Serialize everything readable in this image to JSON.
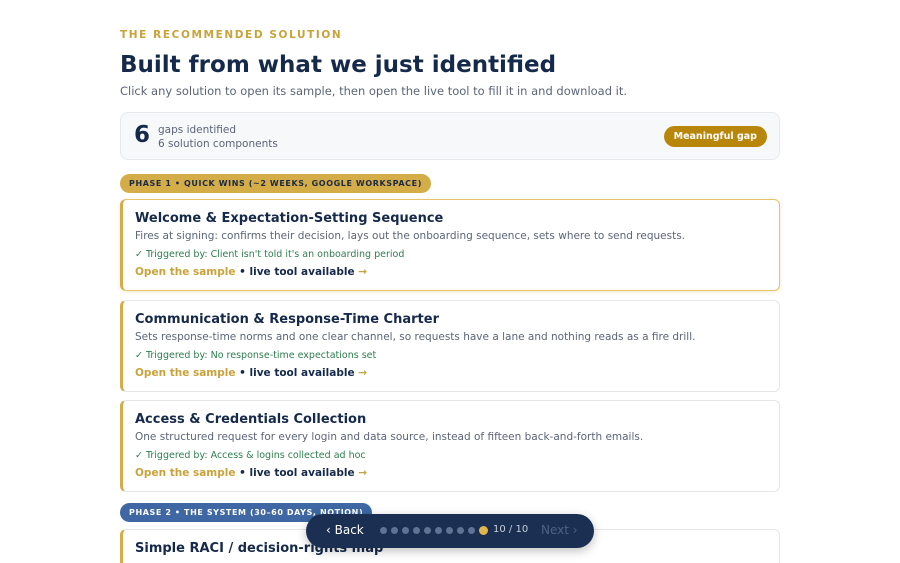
{
  "header": {
    "eyebrow": "THE RECOMMENDED SOLUTION",
    "title": "Built from what we just identified",
    "subtitle": "Click any solution to open its sample, then open the live tool to fill it in and download it."
  },
  "stats": {
    "number": "6",
    "line1": "gaps identified",
    "line2": "6 solution components",
    "badge": "Meaningful gap"
  },
  "phases": [
    {
      "label": "PHASE 1 • QUICK WINS (~2 WEEKS, GOOGLE WORKSPACE)",
      "color": "#d4ac48"
    },
    {
      "label": "PHASE 2 • THE SYSTEM (30–60 DAYS, NOTION)",
      "color": "#3e67a3"
    }
  ],
  "cards": [
    {
      "title": "Welcome & Expectation-Setting Sequence",
      "desc": "Fires at signing: confirms their decision, lays out the onboarding sequence, sets where to send requests.",
      "trigger": "✓ Triggered by: Client isn't told it's an onboarding period",
      "link_open": "Open the sample",
      "link_tool": " • live tool available",
      "arrow": " →"
    },
    {
      "title": "Communication & Response-Time Charter",
      "desc": "Sets response-time norms and one clear channel, so requests have a lane and nothing reads as a fire drill.",
      "trigger": "✓ Triggered by: No response-time expectations set",
      "link_open": "Open the sample",
      "link_tool": " • live tool available",
      "arrow": " →"
    },
    {
      "title": "Access & Credentials Collection",
      "desc": "One structured request for every login and data source, instead of fifteen back-and-forth emails.",
      "trigger": "✓ Triggered by: Access & logins collected ad hoc",
      "link_open": "Open the sample",
      "link_tool": " • live tool available",
      "arrow": " →"
    },
    {
      "title": "Simple RACI / decision-rights map"
    }
  ],
  "nav": {
    "back": "‹ Back",
    "count": "10 / 10",
    "next": "Next ›",
    "total_steps": 10,
    "current_step": 10
  },
  "colors": {
    "accent": "#d4ac48",
    "navy": "#15294b",
    "trigger_green": "#2e7d4f",
    "badge": "#b8860b"
  }
}
